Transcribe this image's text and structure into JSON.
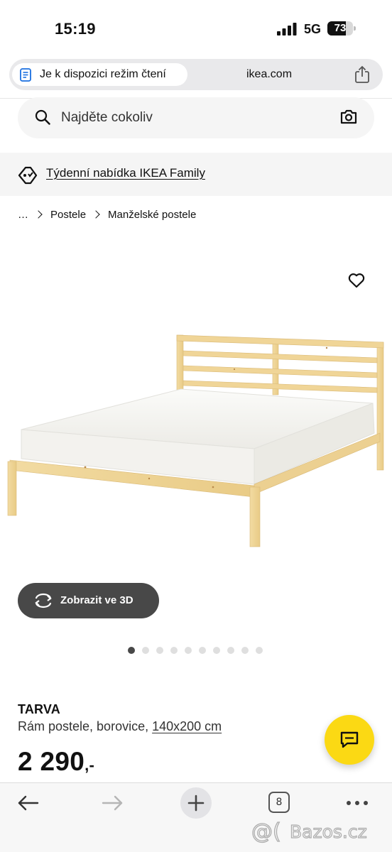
{
  "status_bar": {
    "time": "15:19",
    "network": "5G",
    "battery_percent": "73",
    "battery_level": 0.73
  },
  "browser": {
    "reader_mode_label": "Je k dispozici režim čtení",
    "domain": "ikea.com",
    "icons": [
      "reader-mode-icon",
      "share-icon"
    ]
  },
  "search": {
    "placeholder": "Najděte cokoliv",
    "icons": [
      "search-icon",
      "camera-icon"
    ]
  },
  "family_banner": {
    "label": "Týdenní nabídka IKEA Family",
    "icon": "tag-icon"
  },
  "breadcrumb": {
    "items": [
      "…",
      "Postele",
      "Manželské postele"
    ]
  },
  "product": {
    "view3d_label": "Zobrazit ve 3D",
    "image_count": 10,
    "active_image": 1,
    "name": "TARVA",
    "description": "Rám postele, borovice,",
    "size": "140x200 cm",
    "price": "2 290",
    "price_suffix": ",-"
  },
  "toolbar": {
    "tab_count": "8",
    "icons": [
      "back-arrow-icon",
      "forward-arrow-icon",
      "plus-icon",
      "tabs-icon",
      "more-icon"
    ]
  },
  "colors": {
    "accent_yellow": "#fbd914",
    "dark_button": "#484848",
    "banner_bg": "#f5f5f5",
    "wood": "#f0d79a"
  },
  "watermark": {
    "text": "Bazos.cz"
  }
}
